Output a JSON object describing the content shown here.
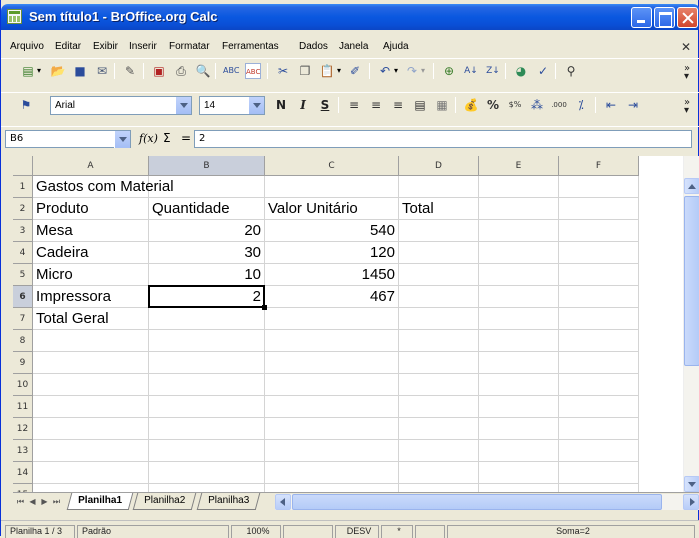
{
  "window": {
    "title": "Sem título1 - BrOffice.org Calc"
  },
  "menubar": {
    "items": [
      "Arquivo",
      "Editar",
      "Exibir",
      "Inserir",
      "Formatar",
      "Ferramentas",
      "Dados",
      "Janela",
      "Ajuda"
    ]
  },
  "toolbar": {
    "font_name": "Arial",
    "font_size": "14",
    "bold": "N",
    "italic": "I",
    "underline": "S",
    "percent": "%",
    "currency": "$%",
    "decimal_add": ".000",
    "icons": [
      "new-icon",
      "open-icon",
      "save-icon",
      "email-icon",
      "edit-file-icon",
      "export-pdf-icon",
      "print-icon",
      "print-preview-icon",
      "spellcheck-icon",
      "autospellcheck-icon",
      "cut-icon",
      "copy-icon",
      "paste-icon",
      "format-paintbrush-icon",
      "undo-icon",
      "redo-icon",
      "hyperlink-icon",
      "sort-ascending-icon",
      "sort-descending-icon",
      "chart-icon",
      "draw-functions-icon",
      "find-replace-icon"
    ]
  },
  "formula": {
    "name_box": "B6",
    "fx": "f(x)",
    "sigma": "Σ",
    "equals": "=",
    "content": "2"
  },
  "grid": {
    "columns": [
      "A",
      "B",
      "C",
      "D",
      "E",
      "F"
    ],
    "selected_column": "B",
    "selected_row": "6",
    "active_cell": "B6",
    "rows": [
      {
        "num": "1",
        "cells": [
          "Gastos com Material",
          "",
          "",
          "",
          "",
          ""
        ]
      },
      {
        "num": "2",
        "cells": [
          "Produto",
          "Quantidade",
          "Valor Unitário",
          "Total",
          "",
          ""
        ]
      },
      {
        "num": "3",
        "cells": [
          "Mesa",
          "20",
          "540",
          "",
          "",
          ""
        ]
      },
      {
        "num": "4",
        "cells": [
          "Cadeira",
          "30",
          "120",
          "",
          "",
          ""
        ]
      },
      {
        "num": "5",
        "cells": [
          "Micro",
          "10",
          "1450",
          "",
          "",
          ""
        ]
      },
      {
        "num": "6",
        "cells": [
          "Impressora",
          "2",
          "467",
          "",
          "",
          ""
        ]
      },
      {
        "num": "7",
        "cells": [
          "Total Geral",
          "",
          "",
          "",
          "",
          ""
        ]
      },
      {
        "num": "8",
        "cells": [
          "",
          "",
          "",
          "",
          "",
          ""
        ]
      },
      {
        "num": "9",
        "cells": [
          "",
          "",
          "",
          "",
          "",
          ""
        ]
      },
      {
        "num": "10",
        "cells": [
          "",
          "",
          "",
          "",
          "",
          ""
        ]
      },
      {
        "num": "11",
        "cells": [
          "",
          "",
          "",
          "",
          "",
          ""
        ]
      },
      {
        "num": "12",
        "cells": [
          "",
          "",
          "",
          "",
          "",
          ""
        ]
      },
      {
        "num": "13",
        "cells": [
          "",
          "",
          "",
          "",
          "",
          ""
        ]
      },
      {
        "num": "14",
        "cells": [
          "",
          "",
          "",
          "",
          "",
          ""
        ]
      },
      {
        "num": "15",
        "cells": [
          "",
          "",
          "",
          "",
          "",
          ""
        ]
      }
    ]
  },
  "sheets": {
    "tabs": [
      "Planilha1",
      "Planilha2",
      "Planilha3"
    ],
    "active": "Planilha1"
  },
  "status": {
    "sheet": "Planilha 1 / 3",
    "style": "Padrão",
    "zoom": "100%",
    "mode": "DESV",
    "modified": "*",
    "sum": "Soma=2"
  }
}
